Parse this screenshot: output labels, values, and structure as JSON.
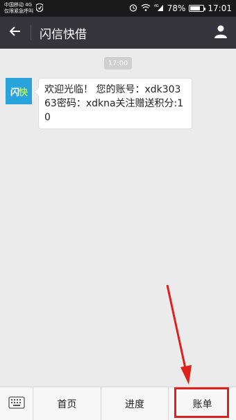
{
  "statusbar": {
    "carrier_line1": "中国移动 4G",
    "carrier_line2": "仅限紧急呼叫",
    "network": "4G",
    "battery_percent": 78,
    "battery_text": "78%",
    "time": "17:01"
  },
  "appbar": {
    "title": "闪信快借"
  },
  "chat": {
    "timestamp": "17:00",
    "avatar_text_a": "闪",
    "avatar_text_b": "快",
    "message": "欢迎光临！ 您的账号：xdk30363密码：xdkna关注赠送积分:10"
  },
  "bottombar": {
    "items": [
      {
        "label": "首页"
      },
      {
        "label": "进度"
      },
      {
        "label": "账单"
      }
    ]
  },
  "colors": {
    "appbar_bg": "#35353b",
    "annotation_red": "#e0201b",
    "avatar_bg": "#29a3dc"
  }
}
